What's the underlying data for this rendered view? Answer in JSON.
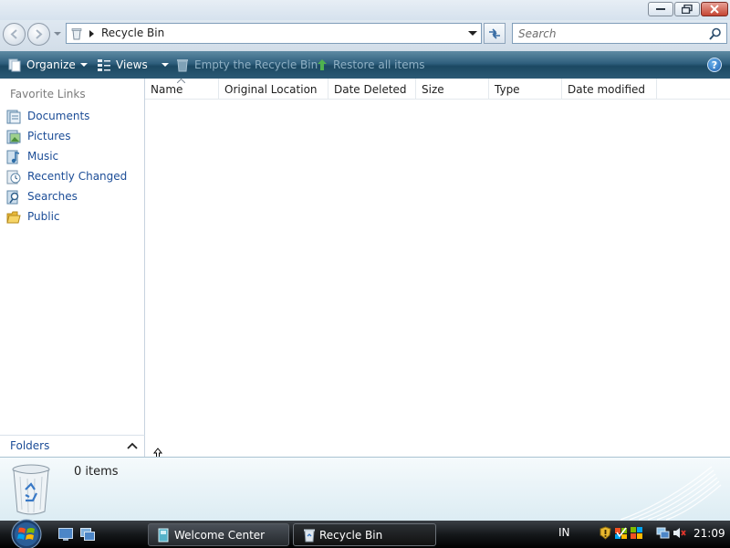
{
  "window": {
    "address": "Recycle Bin",
    "search_placeholder": "Search"
  },
  "toolbar": {
    "organize": "Organize",
    "views": "Views",
    "empty": "Empty the Recycle Bin",
    "restore": "Restore all items",
    "help_symbol": "?"
  },
  "navpane": {
    "heading": "Favorite Links",
    "items": [
      {
        "label": "Documents",
        "icon": "documents-icon"
      },
      {
        "label": "Pictures",
        "icon": "pictures-icon"
      },
      {
        "label": "Music",
        "icon": "music-icon"
      },
      {
        "label": "Recently Changed",
        "icon": "recently-changed-icon"
      },
      {
        "label": "Searches",
        "icon": "searches-icon"
      },
      {
        "label": "Public",
        "icon": "public-folder-icon"
      }
    ],
    "folders_label": "Folders"
  },
  "filelist": {
    "columns": [
      "Name",
      "Original Location",
      "Date Deleted",
      "Size",
      "Type",
      "Date modified"
    ],
    "sorted_column": "Name"
  },
  "details": {
    "count": "0 items"
  },
  "taskbar": {
    "buttons": [
      "Welcome Center",
      "Recycle Bin"
    ],
    "active": "Recycle Bin",
    "language": "IN",
    "clock": "21:09"
  },
  "colors": {
    "command_bar": "#1b4862",
    "link_blue": "#1c4d97",
    "close_red": "#c54533"
  }
}
